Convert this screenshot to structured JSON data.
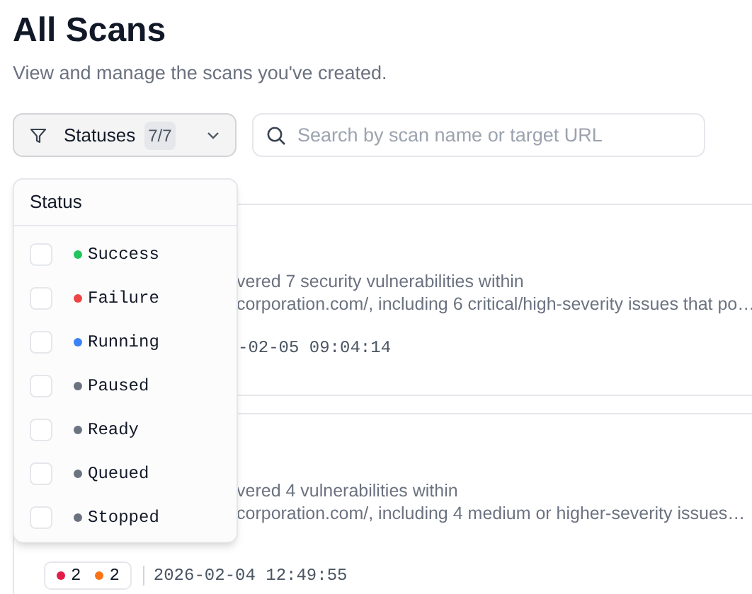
{
  "header": {
    "title": "All Scans",
    "subtitle": "View and manage the scans you've created."
  },
  "filter": {
    "label": "Statuses",
    "count": "7/7",
    "expanded": true
  },
  "search": {
    "placeholder": "Search by scan name or target URL"
  },
  "status_menu": {
    "heading": "Status",
    "items": [
      {
        "label": "Success",
        "color": "#22c55e",
        "checked": false
      },
      {
        "label": "Failure",
        "color": "#ef4444",
        "checked": false
      },
      {
        "label": "Running",
        "color": "#3b82f6",
        "checked": false
      },
      {
        "label": "Paused",
        "color": "#6b7280",
        "checked": false
      },
      {
        "label": "Ready",
        "color": "#6b7280",
        "checked": false
      },
      {
        "label": "Queued",
        "color": "#6b7280",
        "checked": false
      },
      {
        "label": "Stopped",
        "color": "#6b7280",
        "checked": false
      }
    ]
  },
  "scans": [
    {
      "description_lines": [
        "vered 7 security vulnerabilities within",
        "corporation.com/, including 6 critical/high-severity issues that po…"
      ],
      "date": "-02-05 09:04:14"
    },
    {
      "description_lines": [
        "vered 4 vulnerabilities within",
        "corporation.com/, including 4 medium or higher-severity issues…"
      ],
      "severity_counts": [
        {
          "color": "#e11d48",
          "count": "2"
        },
        {
          "color": "#f97316",
          "count": "2"
        }
      ],
      "date": "2026-02-04 12:49:55"
    }
  ]
}
